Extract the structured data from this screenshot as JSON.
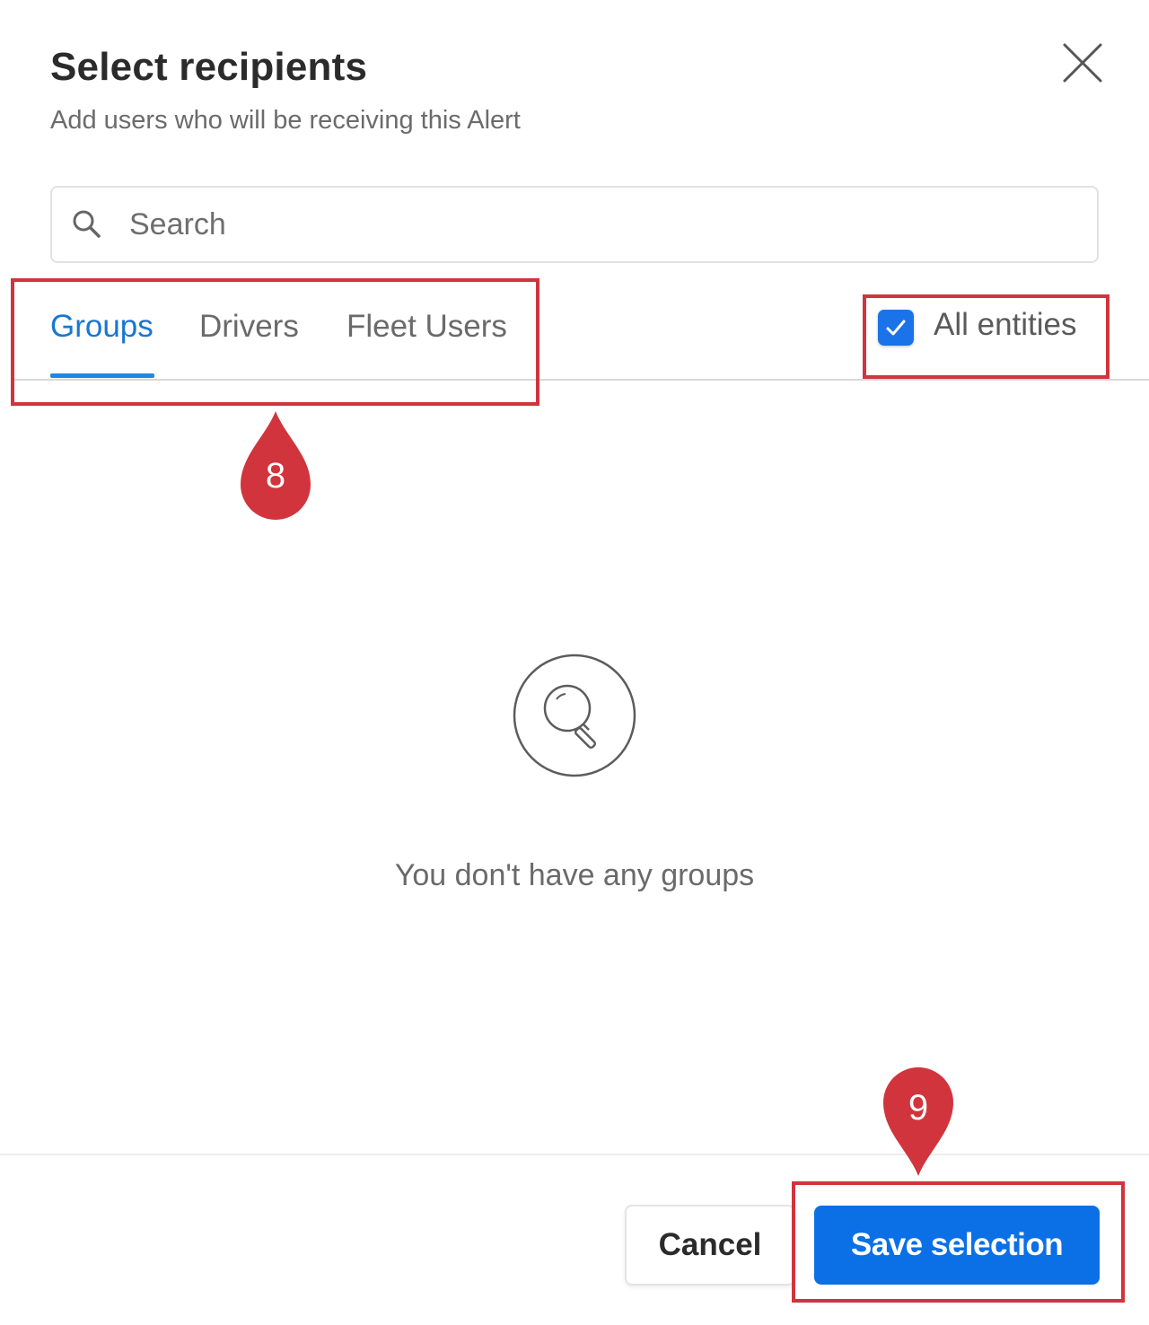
{
  "dialog": {
    "title": "Select recipients",
    "subtitle": "Add users who will be receiving this Alert"
  },
  "search": {
    "placeholder": "Search",
    "value": ""
  },
  "tabs": [
    {
      "label": "Groups",
      "active": true
    },
    {
      "label": "Drivers",
      "active": false
    },
    {
      "label": "Fleet Users",
      "active": false
    }
  ],
  "all_entities": {
    "label": "All entities",
    "checked": true
  },
  "empty_state": {
    "icon": "search-icon",
    "message": "You don't have any groups"
  },
  "footer": {
    "cancel_label": "Cancel",
    "save_label": "Save selection"
  },
  "annotations": {
    "marker_tabs": "8",
    "marker_save": "9"
  },
  "colors": {
    "accent": "#1976d2",
    "primary_button": "#0b6fe6",
    "annotation": "#d1343c"
  }
}
